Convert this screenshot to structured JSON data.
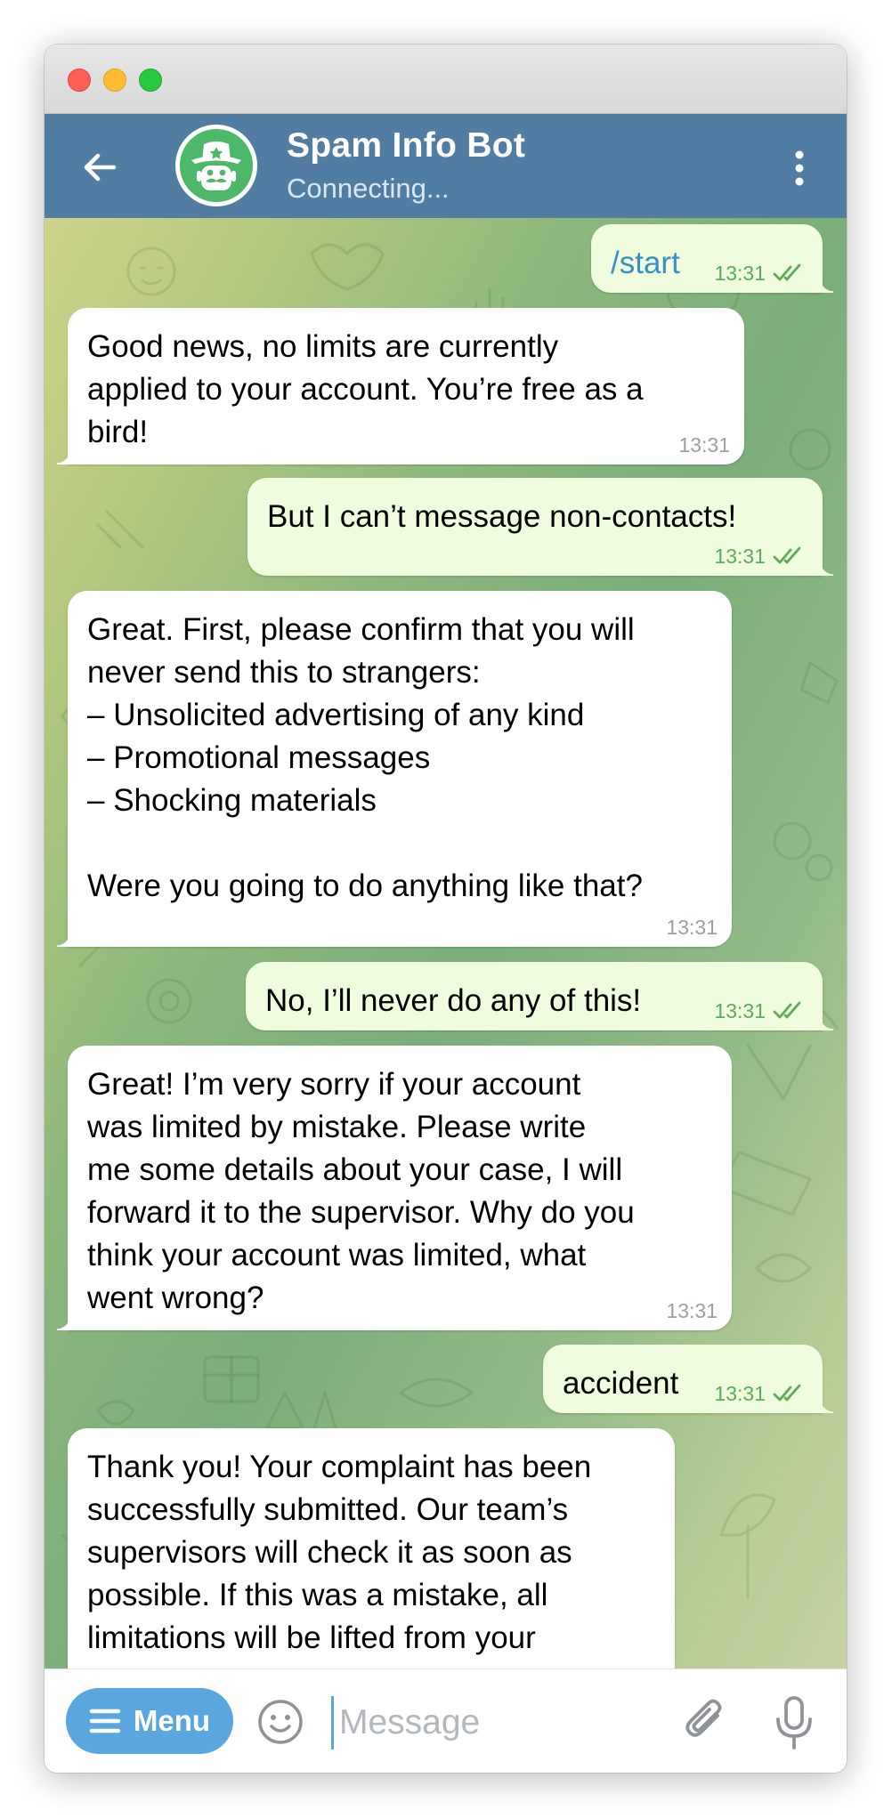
{
  "window": {
    "traffic_lights": [
      "close",
      "minimize",
      "zoom"
    ]
  },
  "header": {
    "title": "Spam Info Bot",
    "status": "Connecting...",
    "back_icon": "arrow-left-icon",
    "more_icon": "kebab-vertical-icon",
    "avatar_icon": "cowboy-bot-icon",
    "color": "#527da3"
  },
  "messages": [
    {
      "direction": "out",
      "text": "/start",
      "time": "13:31",
      "read": true,
      "is_command": true
    },
    {
      "direction": "in",
      "text": "Good news, no limits are currently\napplied to your account. You’re free as a\nbird!",
      "time": "13:31"
    },
    {
      "direction": "out",
      "text": "But I can’t message non-contacts!",
      "time": "13:31",
      "read": true
    },
    {
      "direction": "in",
      "text": "Great. First, please confirm that you will\nnever send this to strangers:\n– Unsolicited advertising of any kind\n– Promotional messages\n– Shocking materials\n\nWere you going to do anything like that?",
      "time": "13:31"
    },
    {
      "direction": "out",
      "text": "No, I’ll never do any of this!",
      "time": "13:31",
      "read": true
    },
    {
      "direction": "in",
      "text": "Great! I’m very sorry if your account\nwas limited by mistake. Please write\nme some details about your case, I will\nforward it to the supervisor. Why do you\nthink your account was limited, what\nwent wrong?",
      "time": "13:31"
    },
    {
      "direction": "out",
      "text": "accident",
      "time": "13:31",
      "read": true
    },
    {
      "direction": "in",
      "text": "Thank you! Your complaint has been\nsuccessfully submitted. Our team’s\nsupervisors will check it as soon as\npossible. If this was a mistake, all\nlimitations will be lifted from your\naccount.",
      "time": ""
    }
  ],
  "composer": {
    "menu_label": "Menu",
    "placeholder": "Message",
    "value": "",
    "emoji_icon": "emoji-smile-icon",
    "attach_icon": "paperclip-icon",
    "mic_icon": "microphone-icon",
    "menu_color": "#5aa7e0"
  },
  "colors": {
    "incoming_bubble": "#ffffff",
    "outgoing_bubble": "#effdde",
    "outgoing_time": "#5faa58",
    "command_link": "#3a8ec5"
  }
}
